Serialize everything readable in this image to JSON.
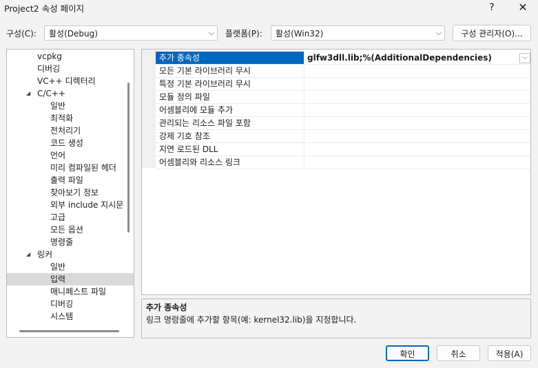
{
  "window": {
    "title": "Project2 속성 페이지",
    "help": "?",
    "close": "✕"
  },
  "toolbar": {
    "config_label": "구성(C):",
    "config_value": "활성(Debug)",
    "platform_label": "플랫폼(P):",
    "platform_value": "활성(Win32)",
    "config_manager": "구성 관리자(O)..."
  },
  "tree": {
    "items": [
      {
        "label": "vcpkg"
      },
      {
        "label": "디버깅"
      },
      {
        "label": "VC++ 디렉터리"
      },
      {
        "label": "C/C++"
      },
      {
        "label": "일반"
      },
      {
        "label": "최적화"
      },
      {
        "label": "전처리기"
      },
      {
        "label": "코드 생성"
      },
      {
        "label": "언어"
      },
      {
        "label": "미리 컴파일된 헤더"
      },
      {
        "label": "출력 파일"
      },
      {
        "label": "찾아보기 정보"
      },
      {
        "label": "외부 include 지시문"
      },
      {
        "label": "고급"
      },
      {
        "label": "모든 옵션"
      },
      {
        "label": "명령줄"
      },
      {
        "label": "링커"
      },
      {
        "label": "일반"
      },
      {
        "label": "입력"
      },
      {
        "label": "매니페스트 파일"
      },
      {
        "label": "디버깅"
      },
      {
        "label": "시스템"
      }
    ]
  },
  "grid": {
    "rows": [
      {
        "name": "추가 종속성",
        "value": "glfw3dll.lib;%(AdditionalDependencies)"
      },
      {
        "name": "모든 기본 라이브러리 무시",
        "value": ""
      },
      {
        "name": "특정 기본 라이브러리 무시",
        "value": ""
      },
      {
        "name": "모듈 정의 파일",
        "value": ""
      },
      {
        "name": "어셈블리에 모듈 추가",
        "value": ""
      },
      {
        "name": "관리되는 리소스 파일 포함",
        "value": ""
      },
      {
        "name": "강제 기호 참조",
        "value": ""
      },
      {
        "name": "지연 로드된 DLL",
        "value": ""
      },
      {
        "name": "어셈블리와 리소스 링크",
        "value": ""
      }
    ]
  },
  "description": {
    "title": "추가 종속성",
    "text": "링크 명령줄에 추가할 항목(예: kernel32.lib)을 지정합니다."
  },
  "buttons": {
    "ok": "확인",
    "cancel": "취소",
    "apply": "적용(A)"
  }
}
